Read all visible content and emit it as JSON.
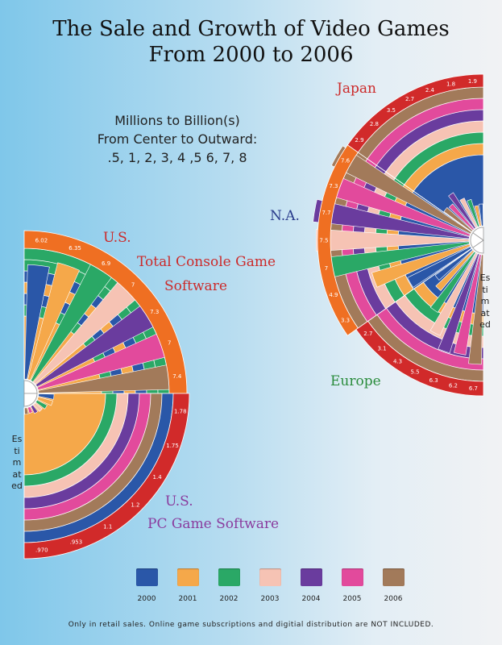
{
  "title_lines": [
    "The Sale and Growth of Video Games",
    "From 2000 to 2006"
  ],
  "scale_note_lines": [
    "Millions to Billion(s)",
    "From Center to Outward:",
    ".5, 1, 2, 3, 4 ,5 6, 7, 8"
  ],
  "labels": {
    "japan": "Japan",
    "na": "N.A.",
    "europe": "Europe",
    "us1": "U.S.",
    "console1": "Total Console Game",
    "console2": "Software",
    "us2": "U.S.",
    "pc": "PC Game Software",
    "estimated": "Estimated"
  },
  "colors": {
    "2000": "#2a57a8",
    "2001": "#f5a84a",
    "2002": "#2aa866",
    "2003": "#f6c3b4",
    "2004": "#6a3c9e",
    "2005": "#e24a9c",
    "2006": "#a27a5a",
    "label_red": "#cc2a2a",
    "label_blue": "#2a3c8c",
    "label_green": "#2a8c3c",
    "label_purple": "#8a3c9e"
  },
  "legend": [
    {
      "year": "2000"
    },
    {
      "year": "2001"
    },
    {
      "year": "2002"
    },
    {
      "year": "2003"
    },
    {
      "year": "2004"
    },
    {
      "year": "2005"
    },
    {
      "year": "2006"
    }
  ],
  "footnote": "Only in retail sales. Online game subscriptions and digitial distribution are NOT INCLUDED.",
  "chart_data": [
    {
      "type": "bar",
      "title": "U.S. Total Console Game Software",
      "categories": [
        "2000",
        "2001",
        "2002",
        "2003",
        "2004",
        "2005",
        "2006"
      ],
      "values": [
        6.02,
        6.35,
        6.9,
        7,
        7.3,
        7,
        7.4
      ],
      "value_labels": [
        "6.02",
        "6.35",
        "6.9",
        "7",
        "7.3",
        "7",
        "7.4"
      ],
      "estimated": "2006"
    },
    {
      "type": "bar",
      "title": "U.S. PC Game Software",
      "categories": [
        "2000",
        "2001",
        "2002",
        "2003",
        "2004",
        "2005",
        "2006"
      ],
      "values": [
        1.78,
        1.75,
        1.4,
        1.2,
        1.1,
        0.953,
        0.97
      ],
      "value_labels": [
        "1.78",
        "1.75",
        "1.4",
        "1.2",
        "1.1",
        ".953",
        ".970"
      ],
      "estimated": "2006"
    },
    {
      "type": "bar",
      "title": "Japan",
      "categories": [
        "2000",
        "2001",
        "2002",
        "2003",
        "2004",
        "2005",
        "2006"
      ],
      "values": [
        1.9,
        1.8,
        2.4,
        2.7,
        3.5,
        2.8,
        2.9
      ],
      "value_labels": [
        "1.9",
        "1.8",
        "2.4",
        "2.7",
        "3.5",
        "2.8",
        "2.9"
      ]
    },
    {
      "type": "bar",
      "title": "N.A.",
      "categories": [
        "2000",
        "2001",
        "2002",
        "2003",
        "2004",
        "2005",
        "2006"
      ],
      "values": [
        3.3,
        4.9,
        7,
        7.5,
        7.7,
        7.3,
        7.6
      ],
      "value_labels": [
        "3.3",
        "4.9",
        "7",
        "7.5",
        "7.7",
        "7.3",
        "7.6"
      ]
    },
    {
      "type": "bar",
      "title": "Europe",
      "categories": [
        "2000",
        "2001",
        "2002",
        "2003",
        "2004",
        "2005",
        "2006"
      ],
      "values": [
        2.7,
        3.1,
        4.3,
        5.5,
        6.3,
        6.2,
        6.7
      ],
      "value_labels": [
        "2.7",
        "3.1",
        "4.3",
        "5.5",
        "6.3",
        "6.2",
        "6.7"
      ],
      "estimated": "2006"
    }
  ]
}
